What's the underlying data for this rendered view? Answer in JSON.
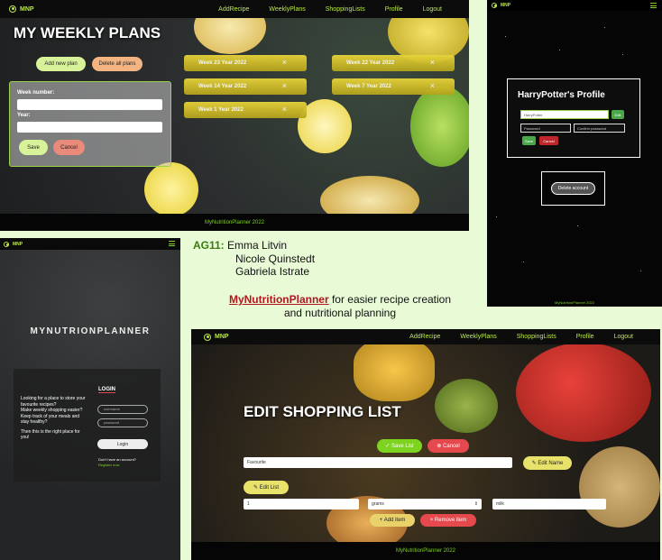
{
  "nav": {
    "brand": "MNP",
    "links": [
      "AddRecipe",
      "WeeklyPlans",
      "ShoppingLists",
      "Profile",
      "Logout"
    ]
  },
  "weekly": {
    "title": "MY WEEKLY PLANS",
    "add_label": "Add new plan",
    "delete_label": "Delete all plans",
    "week_label": "Week number:",
    "year_label": "Year:",
    "save_label": "Save",
    "cancel_label": "Cancel",
    "cards": [
      "Week 23 Year 2022",
      "Week 22 Year 2022",
      "Week 14 Year 2022",
      "Week 7 Year 2022",
      "Week 1 Year 2022"
    ],
    "footer": "MyNutritionPlanner 2022"
  },
  "profile": {
    "title": "HarryPotter's Profile",
    "username_value": "HarryPotter",
    "edit_label": "Edit",
    "password_placeholder": "Password",
    "confirm_placeholder": "Confirm password",
    "save_label": "Save",
    "cancel_label": "Cancel",
    "delete_label": "Delete account",
    "footer": "MyNutritionPlanner 2022"
  },
  "login": {
    "brand": "MNP",
    "app_title": "MYNUTRIONPLANNER",
    "intro_1": "Looking for a place to store your favourite recipes?",
    "intro_2": "Make weekly shopping easier?",
    "intro_3": "Keep track of your meals and stay healthy?",
    "intro_4": "Then this is the right place for you!",
    "heading": "LOGIN",
    "username_placeholder": "username",
    "password_placeholder": "password",
    "button": "Login",
    "no_account": "Don't have an account?",
    "register": "Register now"
  },
  "credits": {
    "group": "AG11:",
    "names": [
      "Emma Litvin",
      "Nicole Quinstedt",
      "Gabriela Istrate"
    ],
    "brand": "MyNutritionPlanner",
    "line1": " for easier recipe creation",
    "line2": "and nutritional planning"
  },
  "shopping": {
    "title": "EDIT SHOPPING LIST",
    "save_label": "Save List",
    "cancel_label": "Cancel",
    "list_name": "Favourite",
    "edit_name_label": "Edit Name",
    "edit_list_label": "Edit List",
    "qty_value": "1",
    "unit_value": "grams",
    "item_value": "milk",
    "add_item_label": "Add item",
    "remove_item_label": "Remove item",
    "footer": "MyNutritionPlanner 2022"
  },
  "colors": {
    "accent": "#b9e84a",
    "danger": "#e5484d",
    "card": "#d8c42c",
    "background": "#e8fbd6"
  }
}
